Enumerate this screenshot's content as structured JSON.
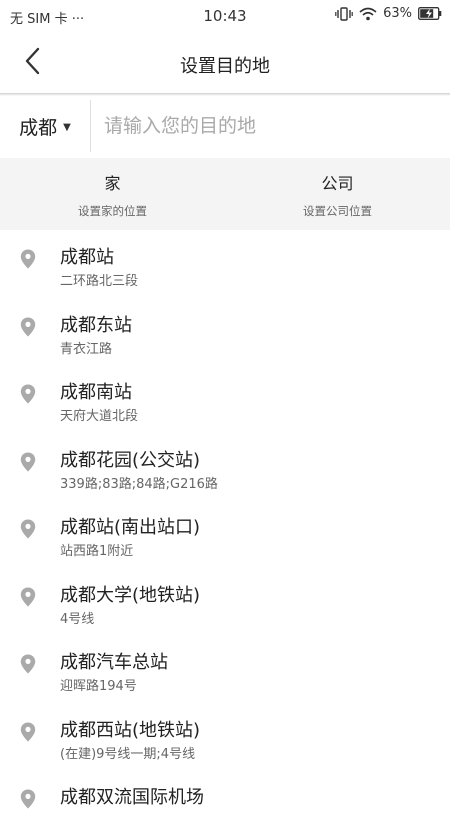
{
  "status_bar": {
    "carrier": "无 SIM 卡 ···",
    "time": "10:43",
    "battery": "63%"
  },
  "header": {
    "title": "设置目的地",
    "back_icon": "chevron-left-icon"
  },
  "search": {
    "city": "成都",
    "placeholder": "请输入您的目的地",
    "value": ""
  },
  "shortcuts": [
    {
      "title": "家",
      "subtitle": "设置家的位置"
    },
    {
      "title": "公司",
      "subtitle": "设置公司位置"
    }
  ],
  "results": [
    {
      "name": "成都站",
      "address": "二环路北三段"
    },
    {
      "name": "成都东站",
      "address": "青衣江路"
    },
    {
      "name": "成都南站",
      "address": "天府大道北段"
    },
    {
      "name": "成都花园(公交站)",
      "address": "339路;83路;84路;G216路"
    },
    {
      "name": "成都站(南出站口)",
      "address": "站西路1附近"
    },
    {
      "name": "成都大学(地铁站)",
      "address": "4号线"
    },
    {
      "name": "成都汽车总站",
      "address": "迎晖路194号"
    },
    {
      "name": "成都西站(地铁站)",
      "address": "(在建)9号线一期;4号线"
    },
    {
      "name": "成都双流国际机场",
      "address": ""
    }
  ],
  "colors": {
    "pin": "#aaaaaa",
    "shortcut_bg": "#f4f4f4",
    "placeholder": "#a9a9a9"
  }
}
